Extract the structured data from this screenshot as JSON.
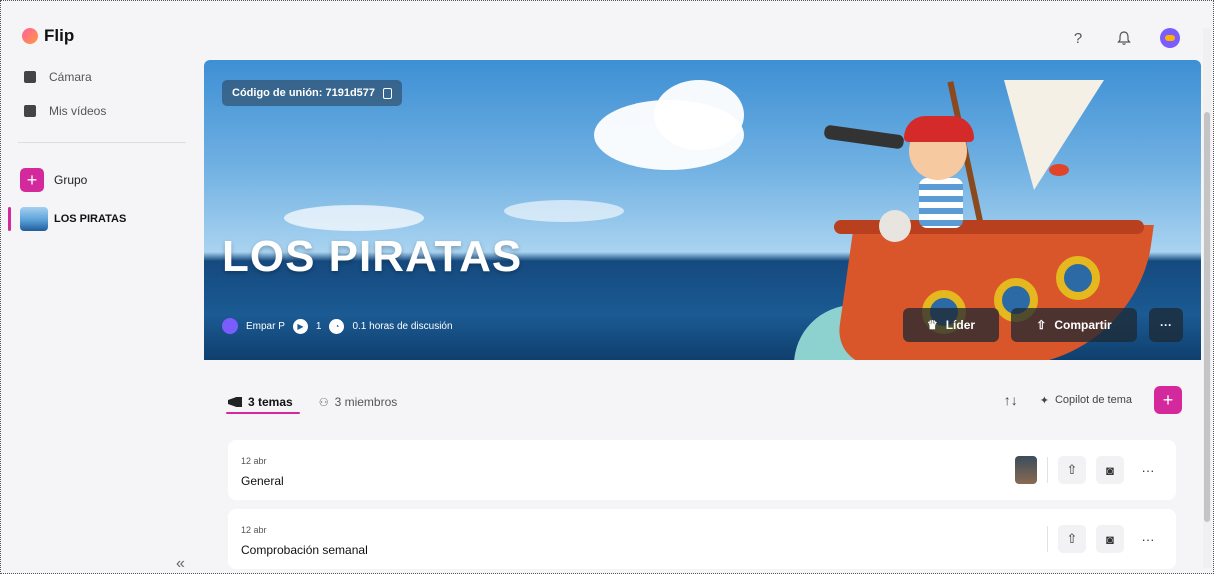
{
  "app": {
    "name": "Flip"
  },
  "header": {
    "help_icon": "?",
    "bell_icon": "bell-icon",
    "avatar": "user-avatar"
  },
  "sidebar": {
    "items": [
      {
        "label": "Cámara",
        "icon": "camera-icon"
      },
      {
        "label": "Mis vídeos",
        "icon": "video-icon"
      }
    ],
    "group_button": {
      "label": "Grupo",
      "icon": "+"
    },
    "groups": [
      {
        "label": "LOS PIRATAS",
        "active": true
      }
    ],
    "collapse_icon": "«"
  },
  "banner": {
    "join_code": "Código de unión: 7191d577",
    "title": "LOS PIRATAS",
    "owner": "Empar P",
    "video_count": "1",
    "discussion": "0.1 horas de discusión",
    "buttons": {
      "leader": "Líder",
      "share": "Compartir",
      "more": "···"
    }
  },
  "tabs": {
    "topics": "3 temas",
    "members": "3 miembros"
  },
  "tools": {
    "sort_icon": "↑↓",
    "copilot": "Copilot de tema",
    "add": "+"
  },
  "topics": [
    {
      "date": "12 abr",
      "name": "General"
    },
    {
      "date": "12 abr",
      "name": "Comprobación semanal"
    }
  ],
  "colors": {
    "accent": "#d4299c",
    "banner_sky": "#6fb0e2",
    "banner_sea": "#1b5a93"
  }
}
